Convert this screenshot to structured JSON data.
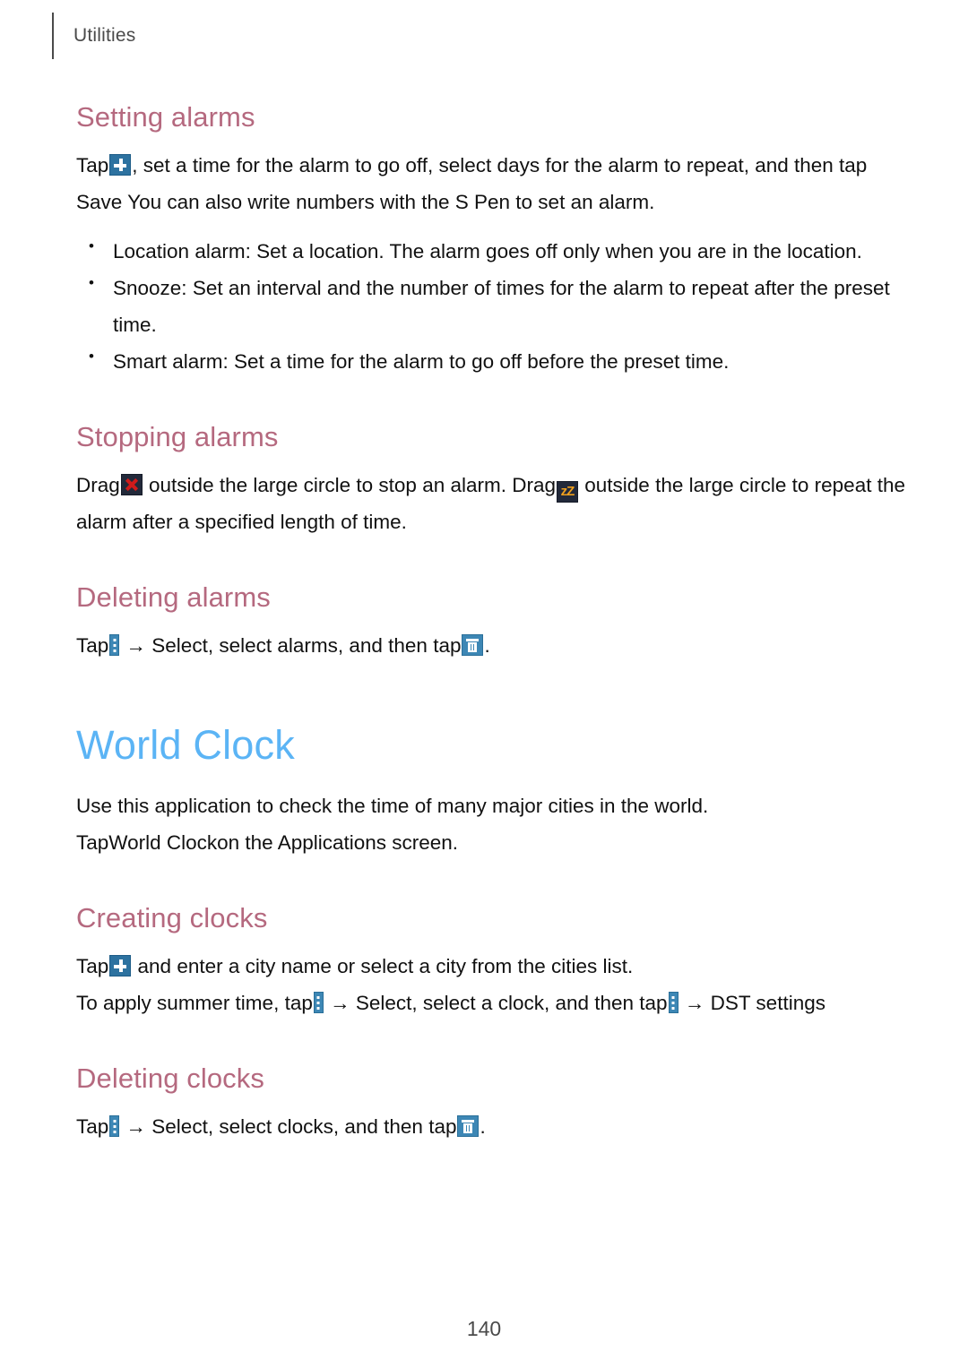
{
  "header": {
    "running_head": "Utilities"
  },
  "footer": {
    "page_number": "140"
  },
  "colors": {
    "section_heading": "#b5697f",
    "chapter_heading": "#5bb4f5",
    "body_text": "#111111",
    "running_head": "#4a4a4a",
    "icon_blue": "#3d87b5",
    "icon_plus_blue": "#2d72a0",
    "icon_dark": "#22293a",
    "icon_red_x": "#cf1b1b",
    "icon_orange_zz": "#f0a01e"
  },
  "icons": {
    "plus": "plus-icon",
    "menu": "more-options-icon",
    "trash": "delete-icon",
    "dismiss": "dismiss-alarm-icon",
    "snooze": "snooze-alarm-icon",
    "arrow": "→"
  },
  "sections": {
    "setting_alarms": {
      "heading": "Setting alarms",
      "paragraph_before_icon": "Tap",
      "paragraph_after_icon": ", set a time for the alarm to go off, select days for the alarm to repeat, and then tap Save You can also write numbers with the S Pen to set an alarm.",
      "bullets": [
        "Location alarm: Set a location. The alarm goes off only when you are in the location.",
        "Snooze: Set an interval and the number of times for the alarm to repeat after the preset time.",
        "Smart alarm: Set a time for the alarm to go off before the preset time."
      ]
    },
    "stopping_alarms": {
      "heading": "Stopping alarms",
      "part1": "Drag",
      "part2": " outside the large circle to stop an alarm. Drag",
      "part3": " outside the large circle to repeat the alarm after a specified length of time."
    },
    "deleting_alarms": {
      "heading": "Deleting alarms",
      "part1": "Tap",
      "part2": " → Select, select alarms, and then tap",
      "part3": "."
    },
    "world_clock": {
      "heading": "World Clock",
      "intro": "Use this application to check the time of many major cities in the world.",
      "launch": "TapWorld Clockon the Applications screen."
    },
    "creating_clocks": {
      "heading": "Creating clocks",
      "line1_part1": "Tap",
      "line1_part2": " and enter a city name or select a city from the cities list.",
      "line2_part1": "To apply summer time, tap",
      "line2_part2": " → Select, select a clock, and then tap",
      "line2_part3": " → DST settings"
    },
    "deleting_clocks": {
      "heading": "Deleting clocks",
      "part1": "Tap",
      "part2": " → Select, select clocks, and then tap",
      "part3": "."
    }
  }
}
